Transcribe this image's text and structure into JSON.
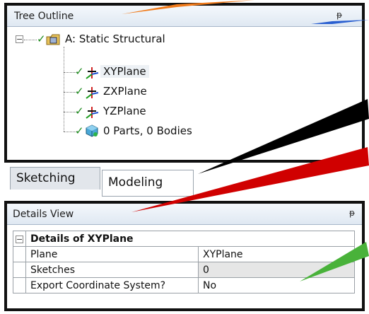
{
  "tree_outline": {
    "title": "Tree Outline",
    "pin_glyph": "ᵽ",
    "items": [
      {
        "label": "A: Static Structural",
        "icon": "static-structural-icon"
      },
      {
        "label": "XYPlane",
        "icon": "plane-axes-icon",
        "selected": true
      },
      {
        "label": "ZXPlane",
        "icon": "plane-axes-icon"
      },
      {
        "label": "YZPlane",
        "icon": "plane-axes-icon"
      },
      {
        "label": "0 Parts, 0 Bodies",
        "icon": "parts-bodies-icon"
      }
    ]
  },
  "tabs": [
    {
      "label": "Sketching"
    },
    {
      "label": "Modeling",
      "active": true
    }
  ],
  "details_view": {
    "title": "Details View",
    "pin_glyph": "ᵽ",
    "group_label": "Details of XYPlane",
    "rows": [
      {
        "name": "Plane",
        "value": "XYPlane"
      },
      {
        "name": "Sketches",
        "value": "0"
      },
      {
        "name": "Export Coordinate System?",
        "value": "No"
      }
    ]
  },
  "colors": {
    "arrow_orange": "#f07a1a",
    "arrow_blue": "#2a5fd0",
    "arrow_black": "#000000",
    "arrow_red": "#d00000",
    "arrow_green": "#49b23a"
  }
}
